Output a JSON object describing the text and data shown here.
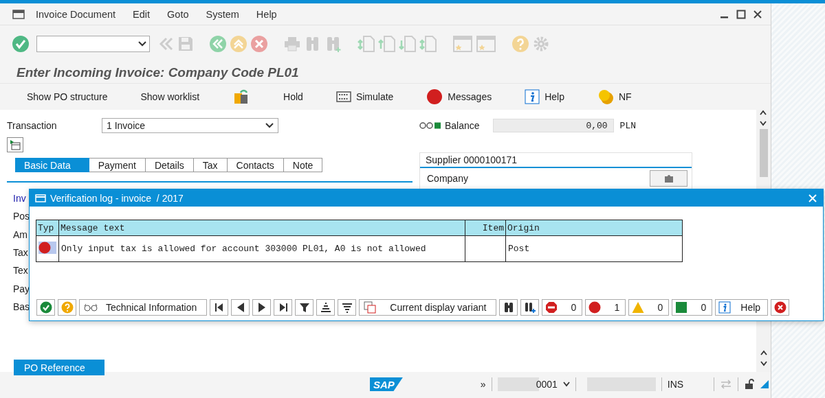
{
  "menu": [
    "Invoice Document",
    "Edit",
    "Goto",
    "System",
    "Help"
  ],
  "title": "Enter Incoming Invoice: Company Code PL01",
  "app_toolbar": [
    {
      "kind": "plain",
      "label": "Show PO structure"
    },
    {
      "kind": "plain",
      "label": "Show worklist"
    },
    {
      "kind": "paste"
    },
    {
      "kind": "plain",
      "label": "Hold"
    },
    {
      "kind": "simulate",
      "label": "Simulate"
    },
    {
      "kind": "messages",
      "label": "Messages"
    },
    {
      "kind": "help",
      "label": "Help"
    },
    {
      "kind": "coins",
      "label": "NF"
    }
  ],
  "transaction": {
    "label": "Transaction",
    "value": "1 Invoice"
  },
  "balance": {
    "label": "Balance",
    "value": "0,00",
    "currency": "PLN"
  },
  "tabs": [
    {
      "label": "Basic Data",
      "selected": true
    },
    {
      "label": "Payment",
      "selected": false
    },
    {
      "label": "Details",
      "selected": false
    },
    {
      "label": "Tax",
      "selected": false
    },
    {
      "label": "Contacts",
      "selected": false
    },
    {
      "label": "Note",
      "selected": false
    }
  ],
  "supplier_panel": {
    "title": "Supplier 0000100171",
    "label": "Company"
  },
  "fields": [
    {
      "label": "Inv",
      "highlighted": true
    },
    {
      "label": "Pos",
      "highlighted": false
    },
    {
      "label": "Am",
      "highlighted": false
    },
    {
      "label": "Tax",
      "highlighted": false
    },
    {
      "label": "Tex",
      "highlighted": false
    },
    {
      "label": "Pay",
      "highlighted": false
    },
    {
      "label": "Bas",
      "highlighted": false
    }
  ],
  "bottom_tab": {
    "label": "PO Reference",
    "selected": true
  },
  "status_bar": {
    "logo": "SAP",
    "arrows": "»",
    "session": "0001",
    "mode": "INS"
  },
  "dialog": {
    "title": "Verification log - invoice  / 2017",
    "columns": [
      "Typ",
      "Message text",
      "Item",
      "Origin"
    ],
    "rows": [
      {
        "kind": "error",
        "message": "Only input tax is allowed for account 303000 PL01, A0 is not allowed",
        "origin": "Post"
      }
    ],
    "technical": "Technical Information",
    "variant": "Current display variant",
    "counts": [
      {
        "kind": "stop",
        "count": "0"
      },
      {
        "kind": "error",
        "count": "1"
      },
      {
        "kind": "warning",
        "count": "0"
      },
      {
        "kind": "success",
        "count": "0"
      }
    ],
    "help": "Help"
  }
}
